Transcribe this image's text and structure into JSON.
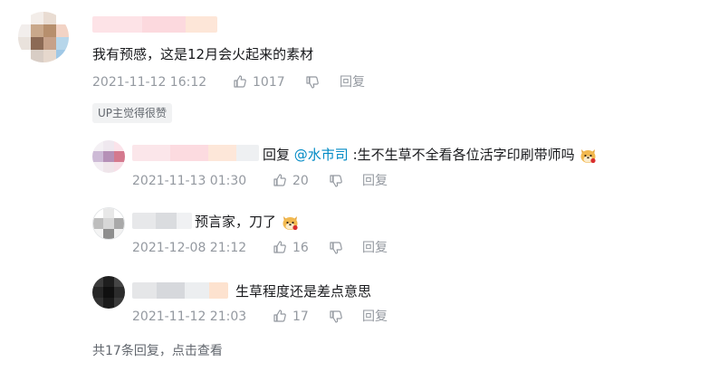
{
  "main_comment": {
    "text": "我有预感，这是12月会火起来的素材",
    "date": "2021-11-12 16:12",
    "likes": "1017",
    "reply_label": "回复",
    "badge": "UP主觉得很赞"
  },
  "replies": [
    {
      "prefix": "回复 ",
      "mention": "@水市司",
      "text": " :生不生草不全看各位活字印刷带师吗",
      "date": "2021-11-13 01:30",
      "likes": "20",
      "reply_label": "回复"
    },
    {
      "text": "预言家，刀了",
      "date": "2021-12-08 21:12",
      "likes": "16",
      "reply_label": "回复"
    },
    {
      "text": "生草程度还是差点意思",
      "date": "2021-11-12 21:03",
      "likes": "17",
      "reply_label": "回复"
    }
  ],
  "footer": {
    "summary": "共17条回复，",
    "link": "点击查看"
  },
  "colors": {
    "meta": "#9499a0",
    "mention": "#008ac5",
    "badge_bg": "#f1f2f3",
    "blur_pink": "#fbd2d8"
  }
}
